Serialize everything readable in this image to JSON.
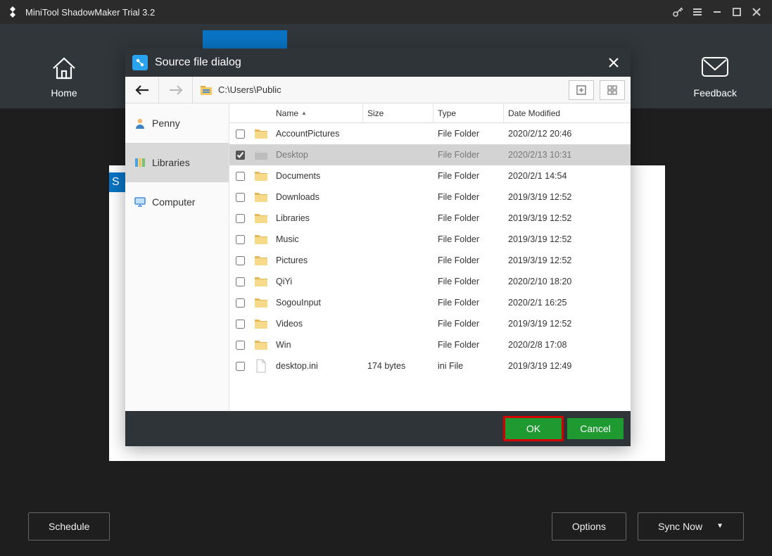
{
  "app": {
    "title": "MiniTool ShadowMaker Trial 3.2"
  },
  "tabs": {
    "home": "Home",
    "feedback": "Feedback"
  },
  "bottom": {
    "schedule": "Schedule",
    "options": "Options",
    "syncnow": "Sync Now"
  },
  "mainbg": {
    "sLabel": "S"
  },
  "dialog": {
    "title": "Source file dialog",
    "path": "C:\\Users\\Public",
    "sidebar": [
      {
        "label": "Penny",
        "kind": "user",
        "selected": false
      },
      {
        "label": "Libraries",
        "kind": "lib",
        "selected": true
      },
      {
        "label": "Computer",
        "kind": "monitor",
        "selected": false
      }
    ],
    "columns": {
      "name": "Name",
      "size": "Size",
      "type": "Type",
      "date": "Date Modified"
    },
    "rows": [
      {
        "checked": false,
        "icon": "folder",
        "name": "AccountPictures",
        "size": "",
        "type": "File Folder",
        "date": "2020/2/12 20:46"
      },
      {
        "checked": true,
        "icon": "folder",
        "name": "Desktop",
        "size": "",
        "type": "File Folder",
        "date": "2020/2/13 10:31"
      },
      {
        "checked": false,
        "icon": "folder",
        "name": "Documents",
        "size": "",
        "type": "File Folder",
        "date": "2020/2/1 14:54"
      },
      {
        "checked": false,
        "icon": "folder",
        "name": "Downloads",
        "size": "",
        "type": "File Folder",
        "date": "2019/3/19 12:52"
      },
      {
        "checked": false,
        "icon": "folder",
        "name": "Libraries",
        "size": "",
        "type": "File Folder",
        "date": "2019/3/19 12:52"
      },
      {
        "checked": false,
        "icon": "folder",
        "name": "Music",
        "size": "",
        "type": "File Folder",
        "date": "2019/3/19 12:52"
      },
      {
        "checked": false,
        "icon": "folder",
        "name": "Pictures",
        "size": "",
        "type": "File Folder",
        "date": "2019/3/19 12:52"
      },
      {
        "checked": false,
        "icon": "folder",
        "name": "QiYi",
        "size": "",
        "type": "File Folder",
        "date": "2020/2/10 18:20"
      },
      {
        "checked": false,
        "icon": "folder",
        "name": "SogouInput",
        "size": "",
        "type": "File Folder",
        "date": "2020/2/1 16:25"
      },
      {
        "checked": false,
        "icon": "folder",
        "name": "Videos",
        "size": "",
        "type": "File Folder",
        "date": "2019/3/19 12:52"
      },
      {
        "checked": false,
        "icon": "folder",
        "name": "Win",
        "size": "",
        "type": "File Folder",
        "date": "2020/2/8 17:08"
      },
      {
        "checked": false,
        "icon": "file",
        "name": "desktop.ini",
        "size": "174 bytes",
        "type": "ini File",
        "date": "2019/3/19 12:49"
      }
    ],
    "buttons": {
      "ok": "OK",
      "cancel": "Cancel"
    }
  }
}
